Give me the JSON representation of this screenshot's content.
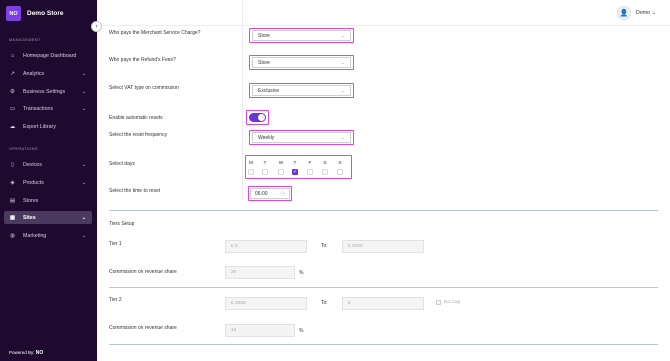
{
  "brand": {
    "logo_text": "NO",
    "name": "Demo Store"
  },
  "sidebar": {
    "sections": [
      {
        "label": "MANAGEMENT"
      },
      {
        "label": "OPERATIONS"
      }
    ],
    "items": [
      {
        "label": "Homepage Dashboard",
        "icon": "home-icon"
      },
      {
        "label": "Analytics",
        "icon": "chart-icon"
      },
      {
        "label": "Business Settings",
        "icon": "gear-icon"
      },
      {
        "label": "Transactions",
        "icon": "card-icon"
      },
      {
        "label": "Export Library",
        "icon": "cloud-icon"
      },
      {
        "label": "Devices",
        "icon": "device-icon"
      },
      {
        "label": "Products",
        "icon": "tag-icon"
      },
      {
        "label": "Stores",
        "icon": "store-icon"
      },
      {
        "label": "Sites",
        "icon": "sites-icon",
        "active": true
      },
      {
        "label": "Marketing",
        "icon": "marketing-icon"
      }
    ],
    "powered_by": "Powered By:",
    "powered_brand": "NO"
  },
  "topbar": {
    "user": "Demo"
  },
  "form": {
    "merchant_fee_label": "Who pays the Merchant Service Charge?",
    "merchant_fee_value": "Store",
    "refund_fee_label": "Who pays the Refund's Fees?",
    "refund_fee_value": "Store",
    "vat_label": "Select VAT type on commission",
    "vat_value": "Exclusive",
    "auto_reset_label": "Enable automatic resets",
    "reset_freq_label": "Select the reset frequency",
    "reset_freq_value": "Weekly",
    "days_label": "Select days",
    "days": [
      "M",
      "T",
      "W",
      "T",
      "F",
      "S",
      "S"
    ],
    "time_label": "Select the time to reset",
    "time_value": "06:00"
  },
  "tiers": {
    "title": "Tiers Setup",
    "to_label": "To:",
    "commission_label": "Commission on revenue share",
    "percent_unit": "%",
    "tier1": {
      "label": "Tier 1",
      "from": "£ 0",
      "to": "£ 2000",
      "commission": "20"
    },
    "tier2": {
      "label": "Tier 2",
      "from": "£ 2000",
      "to": "£",
      "no_cap": "No Cap",
      "commission": "10"
    }
  }
}
